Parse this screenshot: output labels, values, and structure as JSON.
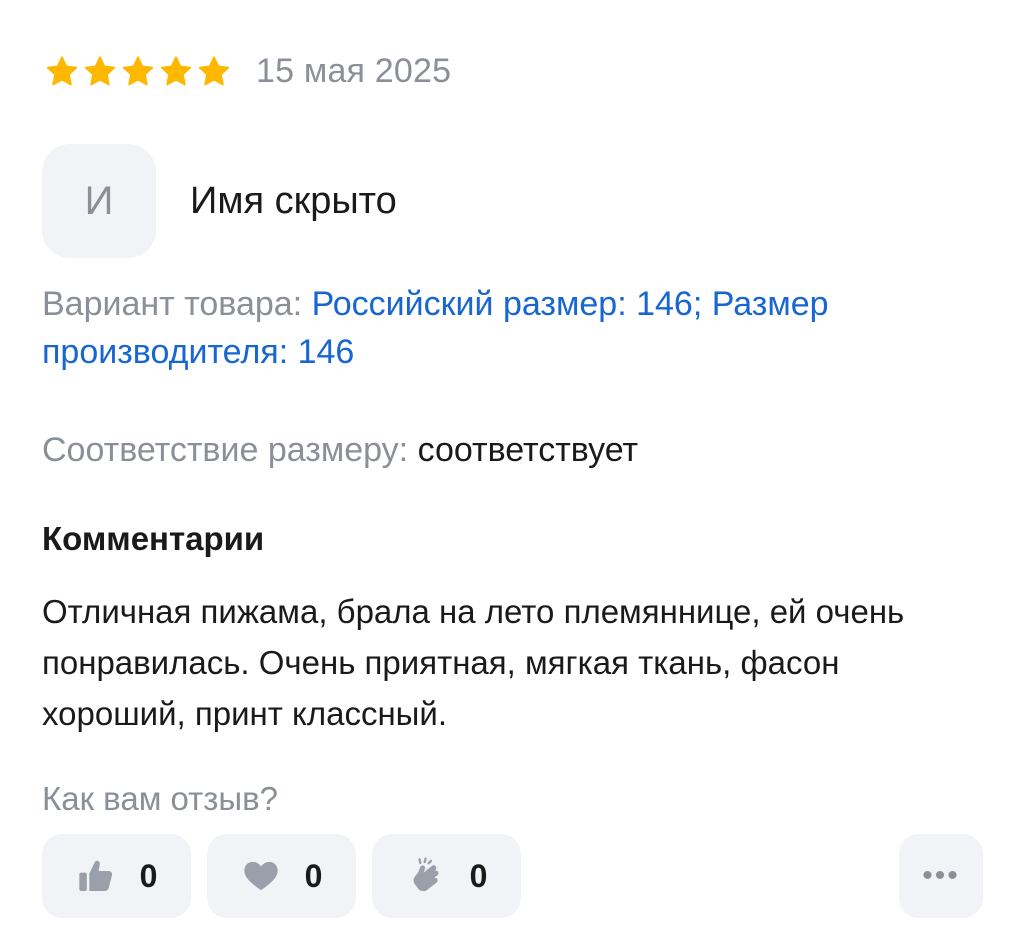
{
  "review": {
    "rating": 5,
    "rating_max": 5,
    "star_color": "#ffb800",
    "date": "15 мая 2025",
    "author": {
      "avatar_letter": "И",
      "name": "Имя скрыто"
    },
    "variant": {
      "label": "Вариант товара: ",
      "value": "Российский размер: 146; Размер производителя: 146"
    },
    "size_fit": {
      "label": "Соответствие размеру: ",
      "value": "соответствует"
    },
    "comments": {
      "title": "Комментарии",
      "text": "Отличная пижама, брала на лето племяннице, ей очень понравилась. Очень приятная, мягкая ткань, фасон хороший, принт классный."
    },
    "feedback": {
      "question": "Как вам отзыв?",
      "reactions": [
        {
          "icon": "thumbs-up-icon",
          "count": "0"
        },
        {
          "icon": "heart-icon",
          "count": "0"
        },
        {
          "icon": "clapping-hands-icon",
          "count": "0"
        }
      ],
      "more_icon": "more-dots-icon",
      "more_label": "•••"
    }
  },
  "colors": {
    "muted": "#8a8f98",
    "link": "#1766d1",
    "chip_bg": "#f1f3f7",
    "icon_gray": "#9aa0aa"
  }
}
